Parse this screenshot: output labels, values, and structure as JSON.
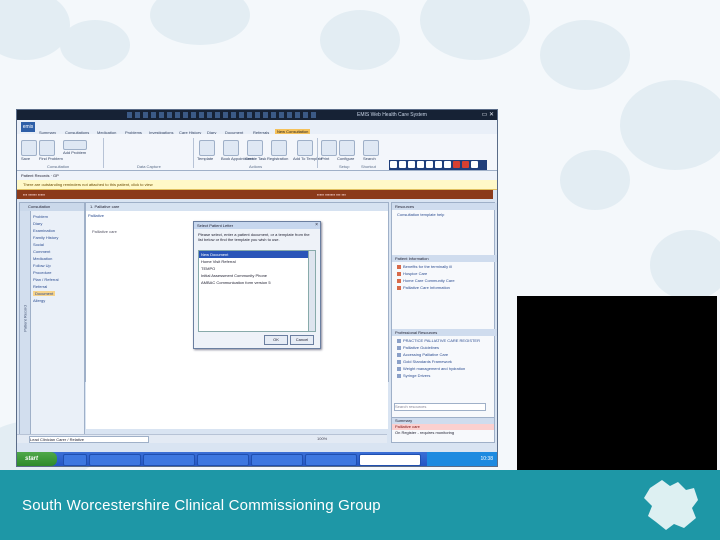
{
  "slide": {
    "footer_title": "South Worcestershire Clinical Commissioning Group"
  },
  "app": {
    "window_title": "EMIS Web Health Care System",
    "logo_text": "emis",
    "menu": [
      "Summary",
      "Consultations",
      "Medication",
      "Problems",
      "Investigations",
      "Care History",
      "Diary",
      "Document",
      "Referrals",
      "New Consultation"
    ],
    "active_tab": "New Consultation",
    "ribbon": {
      "buttons": [
        "Save",
        "Find Problem",
        "Add Problem",
        "Template",
        "Book Appointment",
        "Create Task",
        "Registration",
        "Add To Template",
        "Print",
        "Configure",
        "Search"
      ],
      "groups": [
        "Consultation",
        "Data Capture",
        "Actions",
        "Setup",
        "Shortcut"
      ]
    },
    "alert_text": "There are outstanding reminders not attached to this patient, click to view",
    "patient_bar_text": "Patient Records · GP",
    "left_nav": {
      "header": "Consultation",
      "vertical_tab": "Patient Record",
      "items": [
        "Problem",
        "Diary",
        "Examination",
        "Family History",
        "Social",
        "Comment",
        "Medication",
        "Follow Up",
        "Procedure",
        "Plan / Referral",
        "Referral",
        "Document",
        "Allergy"
      ],
      "selected": "Document"
    },
    "center": {
      "tab_title": "1. Palliative care",
      "sub_header": "Palliative",
      "path_row": "Palliative care"
    },
    "dialog": {
      "title": "Select Patient Letter",
      "message": "Please select, enter a patient document, or a template from the list below or find the template you wish to use.",
      "items": [
        "New Document",
        "Home Visit Referral",
        "TEMPO",
        "Initial Assessment Community Phone",
        "AMBAC Communication form version 5"
      ],
      "selected_index": 0,
      "ok": "OK",
      "cancel": "Cancel"
    },
    "right_panel": {
      "top_header": "Resources",
      "top_item": "Consultation template help",
      "patient_header": "Patient Information",
      "patient_items": [
        "Benefits for the terminally ill",
        "Hospice Care",
        "Home Care Community Care",
        "Palliative Care Information"
      ],
      "prof_header": "Professional Resources",
      "prof_items": [
        "PRACTICE PALLIATIVE CARE REGISTER",
        "Palliative Guidelines",
        "Accessing Palliative Care",
        "Gold Standards Framework",
        "Weight management and hydration",
        "Syringe Drivers"
      ],
      "search_placeholder": "Search resources"
    },
    "summary": {
      "header": "Summary",
      "row1": "Palliative care",
      "row2": "On Register - requires monitoring"
    },
    "status": {
      "input_text": "Lead Clinician Carer / Relative",
      "zoom": "100%"
    },
    "taskbar": {
      "start": "start",
      "clock": "10:38"
    }
  },
  "colors": {
    "footer_band": "#1e97a6",
    "demographic_bar": "#8b3a1a",
    "selected_highlight": "#2a55b8"
  }
}
